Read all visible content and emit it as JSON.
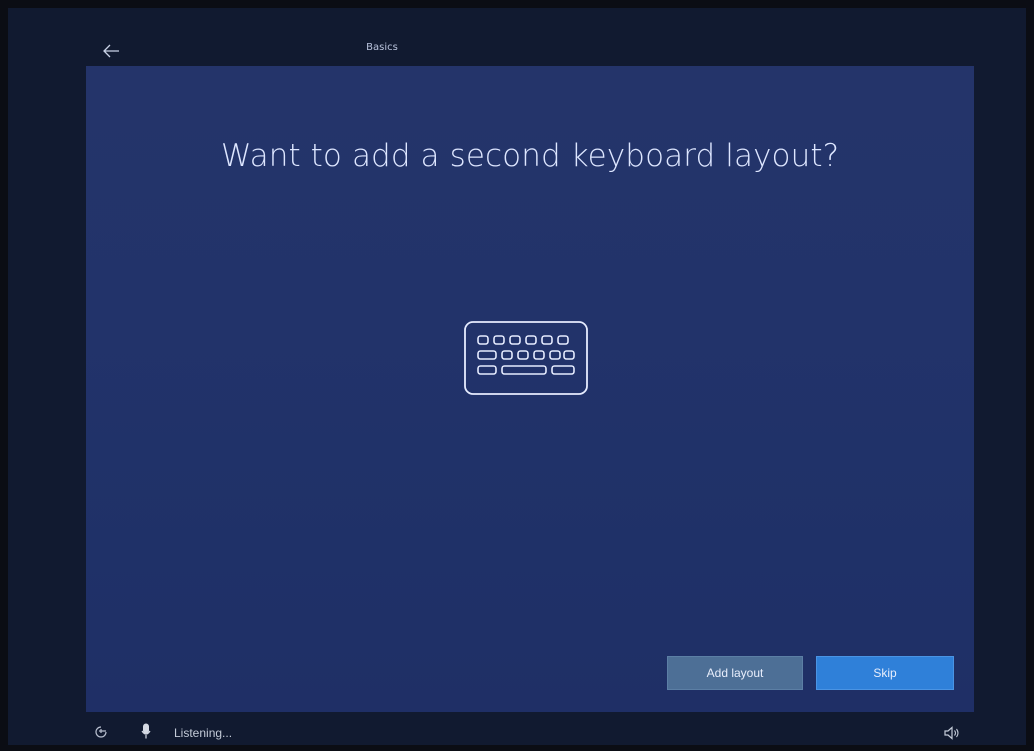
{
  "colors": {
    "panel": "#22336a",
    "title": "#dde6ff",
    "primary_button": "#2f80d9",
    "secondary_button": "#4d6f96"
  },
  "header": {
    "back_icon": "back-arrow-icon",
    "step_label": "Basics"
  },
  "main": {
    "title": "Want to add a second keyboard layout?",
    "illustration_icon": "keyboard-icon"
  },
  "buttons": {
    "add_layout_label": "Add layout",
    "skip_label": "Skip"
  },
  "footer": {
    "ease_of_access_icon": "ease-of-access-icon",
    "mic_icon": "microphone-icon",
    "status": "Listening...",
    "volume_icon": "volume-icon"
  }
}
